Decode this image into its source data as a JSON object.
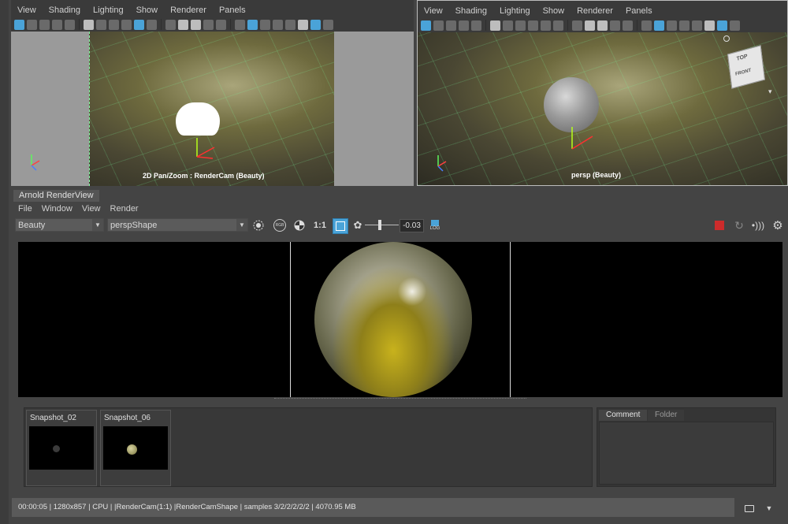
{
  "viewport_left": {
    "menu": [
      "View",
      "Shading",
      "Lighting",
      "Show",
      "Renderer",
      "Panels"
    ],
    "camera_label": "2D Pan/Zoom : RenderCam (Beauty)"
  },
  "viewport_right": {
    "menu": [
      "View",
      "Shading",
      "Lighting",
      "Show",
      "Renderer",
      "Panels"
    ],
    "camera_label": "persp (Beauty)",
    "viewcube_top": "TOP",
    "viewcube_front": "FRONT"
  },
  "renderview": {
    "title": "Arnold RenderView",
    "menu": [
      "File",
      "Window",
      "View",
      "Render"
    ],
    "aov_select": "Beauty",
    "camera_select": "perspShape",
    "rgb_label": "RGB",
    "ratio_label": "1:1",
    "exposure_value": "-0.03",
    "exposure_level": 0.45,
    "log_label": "LOG"
  },
  "snapshots": [
    {
      "label": "Snapshot_02"
    },
    {
      "label": "Snapshot_06"
    }
  ],
  "side_tabs": [
    "Comment",
    "Folder"
  ],
  "status_text": "00:00:05 | 1280x857 | CPU | |RenderCam(1:1) |RenderCamShape | samples 3/2/2/2/2/2 | 4070.95 MB",
  "colors": {
    "accent": "#4aa3d8",
    "stop_render": "#cc2b2b",
    "grid": "#7effa0"
  }
}
